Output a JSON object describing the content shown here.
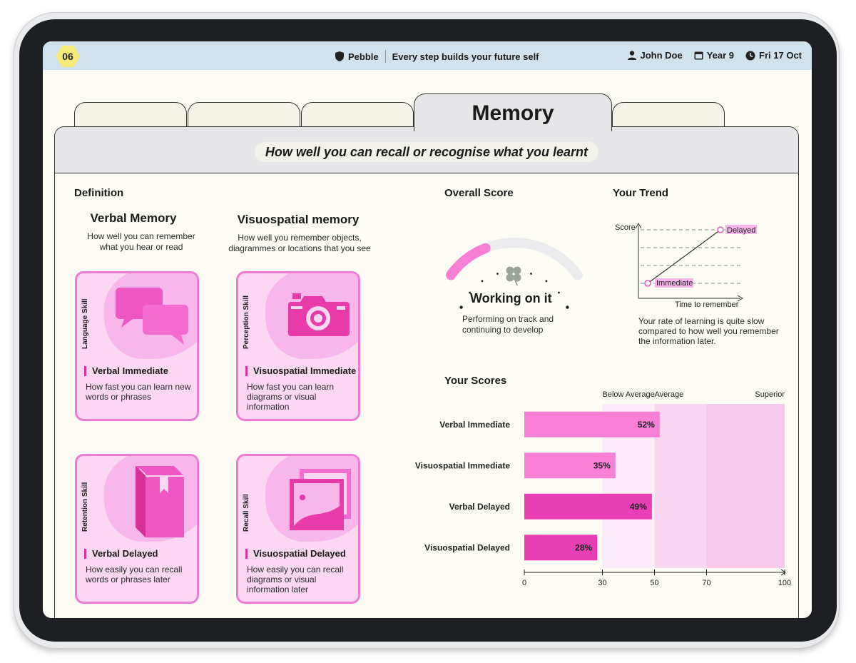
{
  "header": {
    "badge": "06",
    "brand": "Pebble",
    "motto": "Every step builds your future self",
    "user": "John Doe",
    "year": "Year 9",
    "date": "Fri 17 Oct"
  },
  "tabs": [
    {
      "label": ""
    },
    {
      "label": ""
    },
    {
      "label": ""
    },
    {
      "label": "Memory"
    },
    {
      "label": ""
    }
  ],
  "subtitle": "How well you can recall or recognise what you learnt",
  "definition": {
    "title": "Definition",
    "columns": [
      {
        "title": "Verbal Memory",
        "desc_line1": "How well you can remember",
        "desc_line2": "what you hear or read"
      },
      {
        "title": "Visuospatial memory",
        "desc_line1": "How well you remember objects,",
        "desc_line2": "diagrammes or locations that you see"
      }
    ],
    "cards": [
      {
        "skill": "Language Skill",
        "name": "Verbal Immediate",
        "desc": "How fast you can learn new words or phrases",
        "icon": "speech-bubbles-icon"
      },
      {
        "skill": "Perception Skill",
        "name": "Visuospatial Immediate",
        "desc": "How fast you can learn diagrams or visual information",
        "icon": "camera-icon"
      },
      {
        "skill": "Retention Skill",
        "name": "Verbal Delayed",
        "desc": "How easily you can recall words or phrases later",
        "icon": "book-icon"
      },
      {
        "skill": "Recall Skill",
        "name": "Visuospatial Delayed",
        "desc": "How easily you can recall diagrams or visual information later",
        "icon": "photos-icon"
      }
    ]
  },
  "overall": {
    "title": "Overall Score",
    "status": "Working on it",
    "desc_line1": "Performing on track and",
    "desc_line2": "continuing to develop",
    "level": 0.3
  },
  "trend": {
    "title": "Your Trend",
    "y_label": "Score",
    "x_label": "Time to remember",
    "start_label": "Immediate",
    "end_label": "Delayed",
    "desc_line1": "Your rate of learning is quite slow",
    "desc_line2": "compared to how well you remember",
    "desc_line3": "the information later."
  },
  "chart_data": {
    "type": "bar",
    "title": "Your Scores",
    "orientation": "horizontal",
    "categories": [
      "Verbal Immediate",
      "Visuospatial Immediate",
      "Verbal Delayed",
      "Visuospatial Delayed"
    ],
    "values": [
      52,
      35,
      49,
      28
    ],
    "value_labels": [
      "52%",
      "35%",
      "49%",
      "28%"
    ],
    "xlim": [
      0,
      100
    ],
    "x_ticks": [
      0,
      30,
      50,
      70,
      100
    ],
    "bands": [
      {
        "name": "Below Average",
        "from": 30,
        "to": 50
      },
      {
        "name": "Average",
        "from": 50,
        "to": 70
      },
      {
        "name": "Superior",
        "from": 70,
        "to": 100
      }
    ],
    "bar_colors": [
      "#f77fd6",
      "#f77fd6",
      "#e83fb5",
      "#e83fb5"
    ]
  },
  "colors": {
    "accent_pink": "#f07bd2",
    "deep_pink": "#e0339f",
    "topbar": "#cfe2ee",
    "badge": "#f6ea7b"
  }
}
